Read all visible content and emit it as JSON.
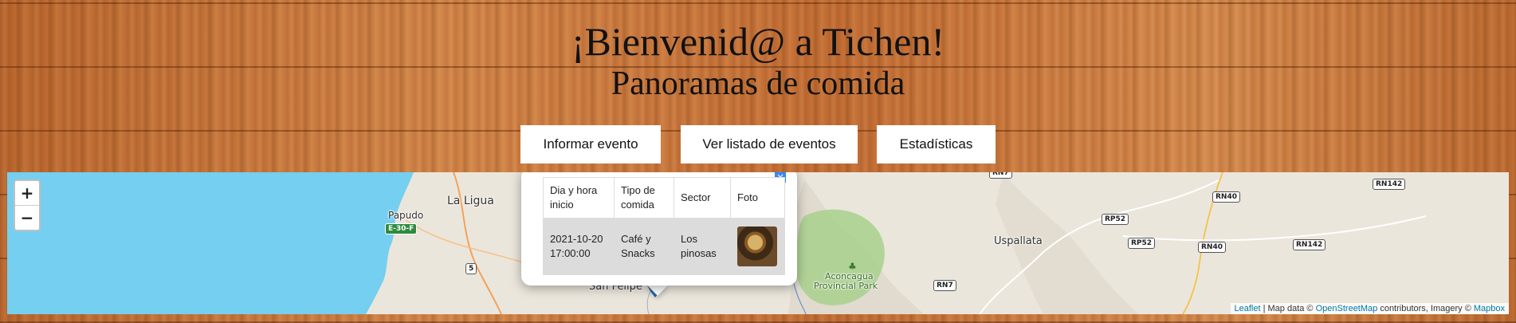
{
  "header": {
    "title": "¡Bienvenid@ a Tichen!",
    "subtitle": "Panoramas de comida"
  },
  "nav": {
    "report_event": "Informar evento",
    "list_events": "Ver listado de eventos",
    "statistics": "Estadísticas"
  },
  "map": {
    "zoom_in": "+",
    "zoom_out": "−",
    "places": [
      "La Ligua",
      "Papudo",
      "Uspallata",
      "San Felipe",
      "Aconcagua",
      "Provincial Park"
    ],
    "road_shields": [
      "E-30-F",
      "5",
      "RP52",
      "RP52",
      "RN40",
      "RN40",
      "RN142",
      "RN142",
      "RN7",
      "RN7"
    ],
    "attribution": {
      "leaflet": "Leaflet",
      "sep": " | Map data © ",
      "osm": "OpenStreetMap",
      "mid": " contributors, Imagery © ",
      "mapbox": "Mapbox"
    },
    "colors": {
      "water": "#75cff0",
      "land": "#ebe6dc",
      "park": "#a8d08d",
      "marker": "#2a81cb",
      "link": "#0078a8"
    }
  },
  "popup": {
    "close": "×",
    "headers": [
      "Dia y hora inicio",
      "Tipo de comida",
      "Sector",
      "Foto"
    ],
    "rows": [
      {
        "datetime": "2021-10-20 17:00:00",
        "food_type": "Café y Snacks",
        "sector": "Los pinosas",
        "photo": "thumbnail"
      }
    ]
  }
}
